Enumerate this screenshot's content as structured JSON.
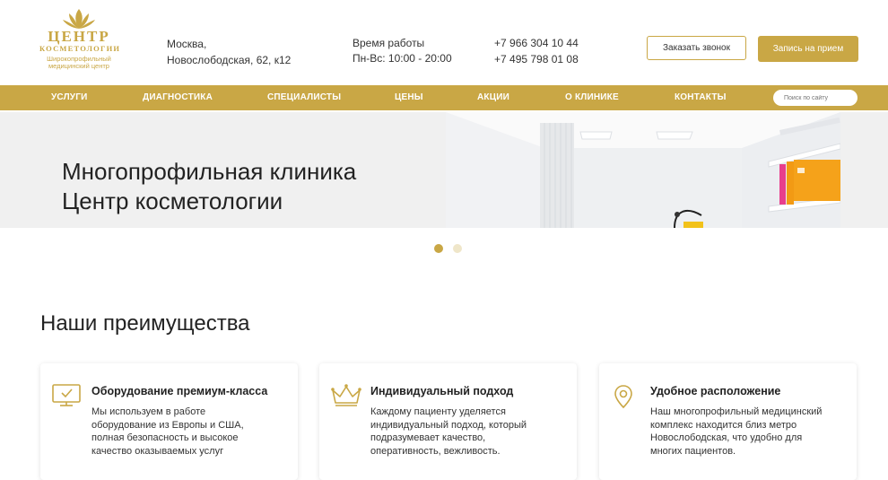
{
  "header": {
    "logo": {
      "title": "ЦЕНТР",
      "subtitle": "КОСМЕТОЛОГИИ",
      "tagline_1": "Широкопрофильный",
      "tagline_2": "медицинский центр"
    },
    "address": {
      "line1": "Москва,",
      "line2": "Новослободская, 62, к12"
    },
    "hours": {
      "line1": "Время работы",
      "line2": "Пн-Вс: 10:00 - 20:00"
    },
    "phones": [
      "+7 966 304 10 44",
      "+7 495 798 01 08"
    ],
    "call_button": "Заказать звонок",
    "book_button": "Запись на прием"
  },
  "nav": {
    "items": [
      "УСЛУГИ",
      "ДИАГНОСТИКА",
      "СПЕЦИАЛИСТЫ",
      "ЦЕНЫ",
      "АКЦИИ",
      "О КЛИНИКЕ",
      "КОНТАКТЫ"
    ],
    "search_placeholder": "Поиск по сайту"
  },
  "hero": {
    "title_line1": "Многопрофильная клиника",
    "title_line2": "Центр косметологии",
    "slides_total": 2,
    "active_slide": 1
  },
  "advantages": {
    "title": "Наши преимущества",
    "cards": [
      {
        "icon": "monitor-check-icon",
        "title": "Оборудование премиум-класса",
        "text": "Мы используем в работе оборудование из Европы и США, полная безопасность и высокое качество оказываемых услуг"
      },
      {
        "icon": "crown-icon",
        "title": "Индивидуальный подход",
        "text": "Каждому пациенту уделяется индивидуальный подход, который подразумевает качество, оперативность, вежливость."
      },
      {
        "icon": "map-pin-icon",
        "title": "Удобное расположение",
        "text": "Наш многопрофильный медицинский комплекс находится близ метро Новослободская, что удобно для многих пациентов."
      }
    ]
  },
  "colors": {
    "accent": "#c9a745",
    "hero_bg": "#f0f0f0",
    "dot_inactive": "#efe6c9"
  }
}
